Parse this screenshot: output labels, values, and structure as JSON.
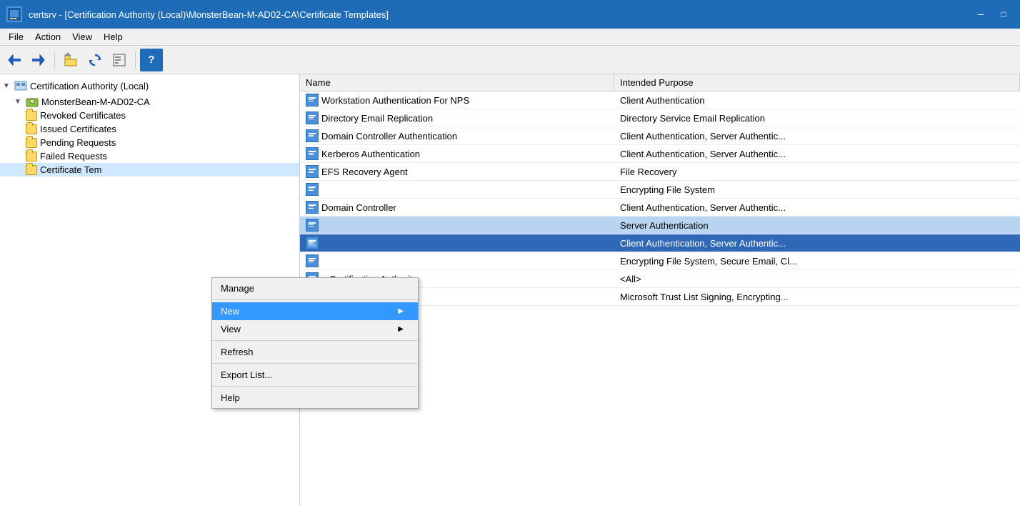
{
  "titleBar": {
    "title": "certsrv - [Certification Authority (Local)\\MonsterBean-M-AD02-CA\\Certificate Templates]",
    "minimizeLabel": "─",
    "maximizeLabel": "□"
  },
  "menuBar": {
    "items": [
      {
        "id": "file",
        "label": "File"
      },
      {
        "id": "action",
        "label": "Action"
      },
      {
        "id": "view",
        "label": "View"
      },
      {
        "id": "help",
        "label": "Help"
      }
    ]
  },
  "toolbar": {
    "buttons": [
      {
        "id": "back",
        "icon": "◀",
        "label": "Back"
      },
      {
        "id": "forward",
        "icon": "▶",
        "label": "Forward"
      },
      {
        "id": "up",
        "icon": "⬆",
        "label": "Up"
      },
      {
        "id": "refresh",
        "icon": "↺",
        "label": "Refresh"
      },
      {
        "id": "export",
        "icon": "📋",
        "label": "Export"
      },
      {
        "id": "help",
        "icon": "?",
        "label": "Help"
      }
    ]
  },
  "treeView": {
    "root": {
      "label": "Certification Authority (Local)",
      "expanded": true,
      "children": [
        {
          "label": "MonsterBean-M-AD02-CA",
          "expanded": true,
          "children": [
            {
              "label": "Revoked Certificates"
            },
            {
              "label": "Issued Certificates"
            },
            {
              "label": "Pending Requests"
            },
            {
              "label": "Failed Requests"
            },
            {
              "label": "Certificate Templates",
              "selected": true
            }
          ]
        }
      ]
    }
  },
  "listView": {
    "columns": [
      {
        "id": "name",
        "label": "Name"
      },
      {
        "id": "purpose",
        "label": "Intended Purpose"
      }
    ],
    "rows": [
      {
        "name": "Workstation Authentication For NPS",
        "purpose": "Client Authentication"
      },
      {
        "name": "Directory Email Replication",
        "purpose": "Directory Service Email Replication"
      },
      {
        "name": "Domain Controller Authentication",
        "purpose": "Client Authentication, Server Authentic..."
      },
      {
        "name": "Kerberos Authentication",
        "purpose": "Client Authentication, Server Authentic..."
      },
      {
        "name": "EFS Recovery Agent",
        "purpose": "File Recovery"
      },
      {
        "name": "",
        "purpose": "Encrypting File System"
      },
      {
        "name": "Domain Controller",
        "purpose": "Client Authentication, Server Authentic..."
      },
      {
        "name": "",
        "purpose": "Server Authentication",
        "highlighted": true
      },
      {
        "name": "",
        "purpose": "Client Authentication, Server Authentic...",
        "selected": true
      },
      {
        "name": "",
        "purpose": "Encrypting File System, Secure Email, Cl..."
      },
      {
        "name": "e Certification Authority",
        "purpose": "<All>"
      },
      {
        "name": "or",
        "purpose": "Microsoft Trust List Signing, Encrypting..."
      }
    ]
  },
  "contextMenu": {
    "items": [
      {
        "id": "manage",
        "label": "Manage",
        "hasSubmenu": false
      },
      {
        "id": "new",
        "label": "New",
        "hasSubmenu": true
      },
      {
        "id": "view",
        "label": "View",
        "hasSubmenu": true
      },
      {
        "id": "refresh",
        "label": "Refresh",
        "hasSubmenu": false
      },
      {
        "id": "export",
        "label": "Export List...",
        "hasSubmenu": false
      },
      {
        "id": "help",
        "label": "Help",
        "hasSubmenu": false
      }
    ]
  },
  "icons": {
    "certTemplate": "📄",
    "folder": "📁",
    "ca": "🏢"
  }
}
